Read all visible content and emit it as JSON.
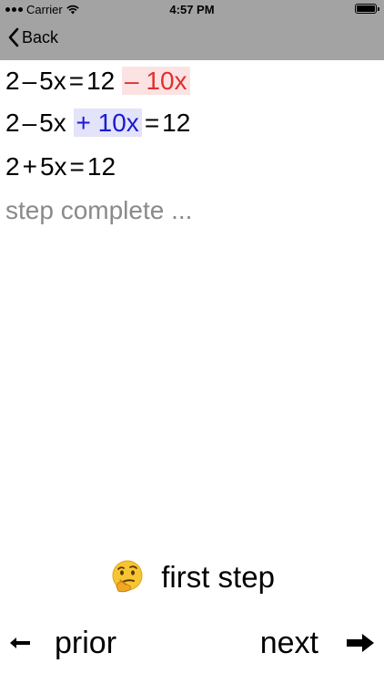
{
  "status_bar": {
    "carrier": "Carrier",
    "time": "4:57 PM"
  },
  "nav": {
    "back_label": "Back"
  },
  "equations": [
    {
      "parts": [
        "2",
        "–",
        "5x",
        "=",
        "12"
      ],
      "highlight": {
        "op": "–",
        "term": "10x",
        "color": "red"
      }
    },
    {
      "parts_before": [
        "2",
        "–",
        "5x"
      ],
      "highlight": {
        "op": "+",
        "term": "10x",
        "color": "blue"
      },
      "parts_after": [
        "=",
        "12"
      ]
    },
    {
      "parts": [
        "2",
        "+",
        "5x",
        "=",
        "12"
      ]
    }
  ],
  "step_status": "step complete ...",
  "hint": {
    "icon": "thinking-face-icon",
    "label": "first step"
  },
  "footer": {
    "prior_label": "prior",
    "next_label": "next"
  },
  "colors": {
    "bar_background": "#a3a3a3",
    "highlight_red": "#e62e2e",
    "highlight_red_bg": "#fbe3e3",
    "highlight_blue": "#1a1ad4",
    "highlight_blue_bg": "#e3e3f9",
    "status_grey": "#8a8a8a"
  }
}
